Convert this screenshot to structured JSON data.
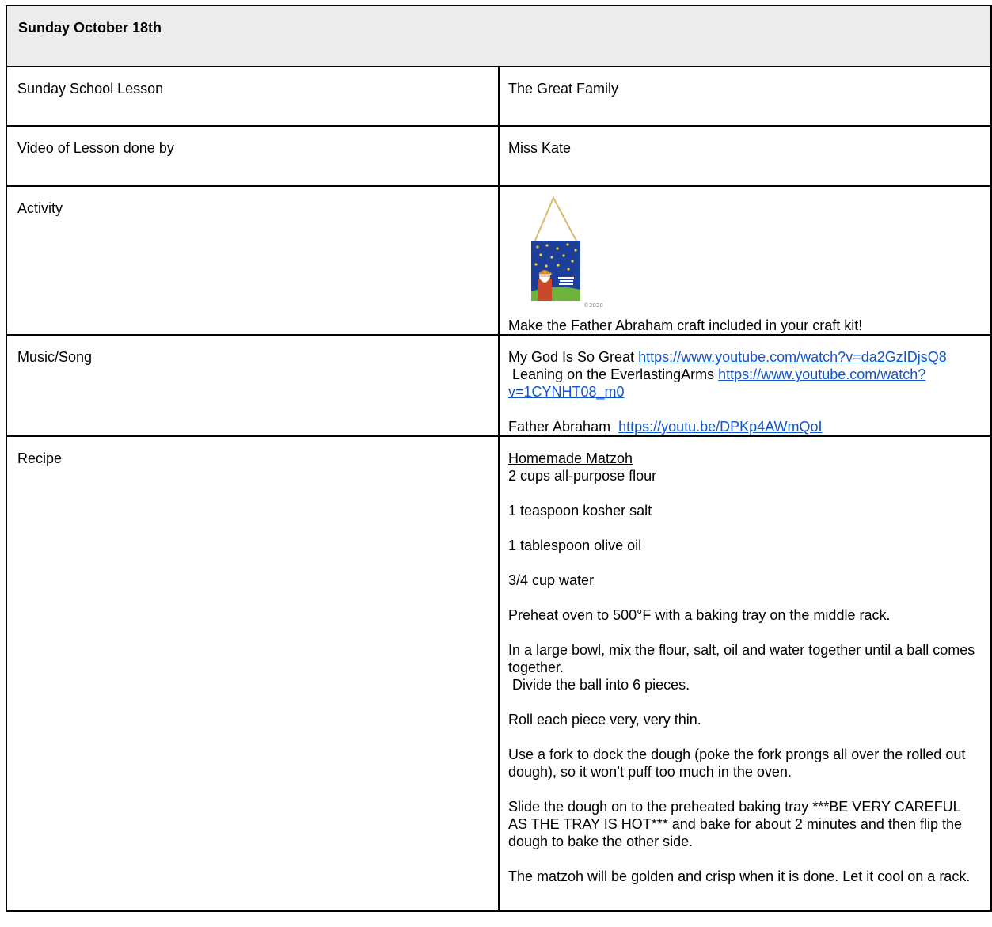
{
  "header": {
    "title": "Sunday October 18th"
  },
  "rows": {
    "lesson": {
      "label": "Sunday School Lesson",
      "value": "The Great Family"
    },
    "video": {
      "label": "Video of Lesson done by",
      "value": "Miss Kate"
    },
    "activity": {
      "label": "Activity",
      "image_caption": "©2020",
      "text": "Make the Father Abraham craft included in your craft kit!"
    },
    "music": {
      "label": "Music/Song",
      "songs": [
        {
          "title": "My God Is So Great ",
          "link": "https://www.youtube.com/watch?v=da2GzIDjsQ8"
        },
        {
          "title": " Leaning on the EverlastingArms ",
          "link": "https://www.youtube.com/watch?v=1CYNHT08_m0"
        },
        {
          "title": "Father Abraham  ",
          "link": "https://youtu.be/DPKp4AWmQoI"
        }
      ]
    },
    "recipe": {
      "label": "Recipe",
      "title": "Homemade Matzoh",
      "ingredients": [
        "2 cups all-purpose flour",
        "1 teaspoon kosher salt",
        "1 tablespoon olive oil",
        "3/4 cup water"
      ],
      "steps": [
        "Preheat oven to 500°F with a baking tray on the middle rack.",
        "In a large bowl, mix the flour, salt, oil and water together until a ball comes together.",
        " Divide the ball into 6 pieces.",
        "Roll each piece very, very thin.",
        "Use a fork to dock the dough (poke the fork prongs all over the rolled out dough), so it won’t puff too much in the oven.",
        "Slide the dough on to the preheated baking tray ***BE VERY CAREFUL AS THE TRAY IS HOT*** and bake for about 2 minutes and then flip the dough to bake the other side.",
        "The matzoh will be golden and crisp when it is done. Let it cool on a rack."
      ]
    }
  }
}
